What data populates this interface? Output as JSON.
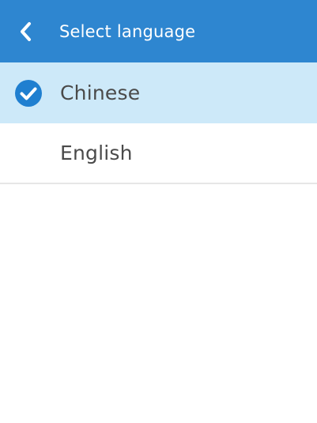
{
  "header": {
    "back_icon": "chevron-left-icon",
    "title": "Select language"
  },
  "languages": [
    {
      "label": "Chinese",
      "selected": true,
      "icon": "check-circle-icon"
    },
    {
      "label": "English",
      "selected": false
    }
  ],
  "colors": {
    "header_bg": "#2e86d0",
    "selected_row_bg": "#cde9f9",
    "check_icon": "#1f7fd0",
    "text": "#4a4a4a",
    "divider": "#e6e6e6"
  }
}
